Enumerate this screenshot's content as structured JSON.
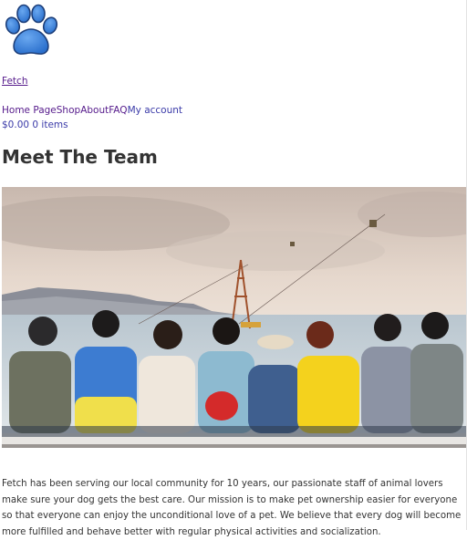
{
  "site": {
    "name": "Fetch",
    "brand_color": "#3a7fd5"
  },
  "nav": {
    "items": [
      {
        "label": "Home Page"
      },
      {
        "label": "Shop"
      },
      {
        "label": "About"
      },
      {
        "label": "FAQ"
      },
      {
        "label": "My account"
      }
    ]
  },
  "cart": {
    "total": "$0.00",
    "count": "0 items"
  },
  "page": {
    "title": "Meet The Team",
    "hero_icon": "team-photo",
    "body": "Fetch has been serving our local community for 10 years, our passionate staff of animal lovers make sure your dog gets the best care. Our mission is to make pet ownership easier for everyone so that everyone can enjoy the unconditional love of a pet. We believe that every dog will become more fulfilled and behave better with regular physical activities and socialization."
  }
}
